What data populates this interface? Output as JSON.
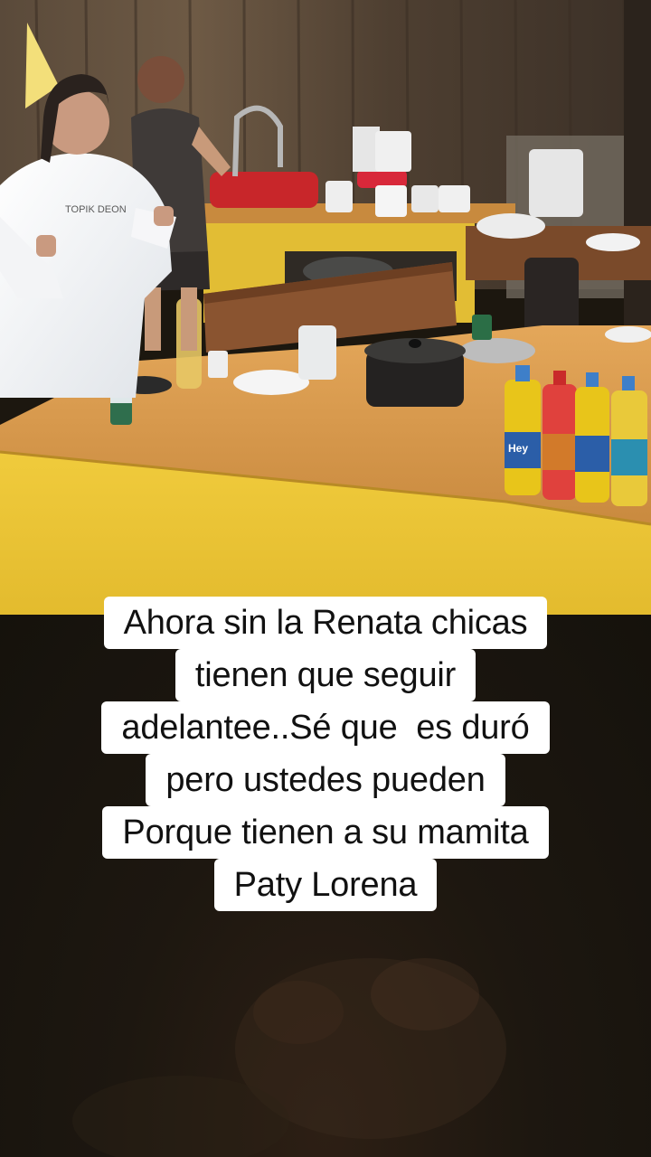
{
  "caption": {
    "lines": [
      "Ahora sin la Renata chicas",
      "tienen que seguir",
      "adelantee..Sé que  es duró",
      "pero ustedes pueden",
      "Porque tienen a su mamita",
      "Paty Lorena"
    ]
  },
  "scene": {
    "hoodie_text": "TOPIK DEON",
    "bottle_label": "Hey"
  },
  "colors": {
    "counter_yellow": "#e9c43a",
    "countertop_wood": "#d99a4e",
    "background_dark": "#1c170f",
    "caption_bg": "#ffffff"
  }
}
